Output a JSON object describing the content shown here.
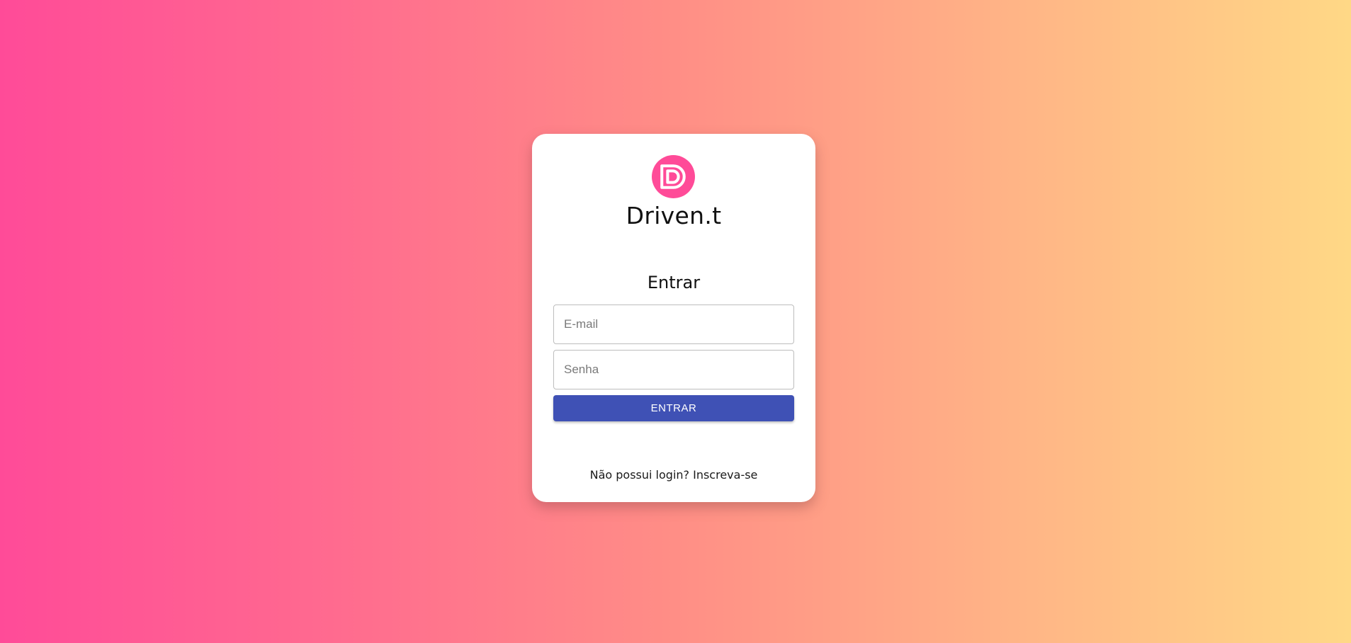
{
  "brand": {
    "name": "Driven.t",
    "logo_icon": "driven-d-logo",
    "logo_color": "#ff4b98"
  },
  "form": {
    "title": "Entrar",
    "email_placeholder": "E-mail",
    "email_value": "",
    "password_placeholder": "Senha",
    "password_value": "",
    "submit_label": "ENTRAR"
  },
  "footer": {
    "signup_link": "Não possui login? Inscreva-se"
  },
  "colors": {
    "button": "#3f51b5",
    "gradient_start": "#ff4b98",
    "gradient_end": "#ffd886"
  }
}
